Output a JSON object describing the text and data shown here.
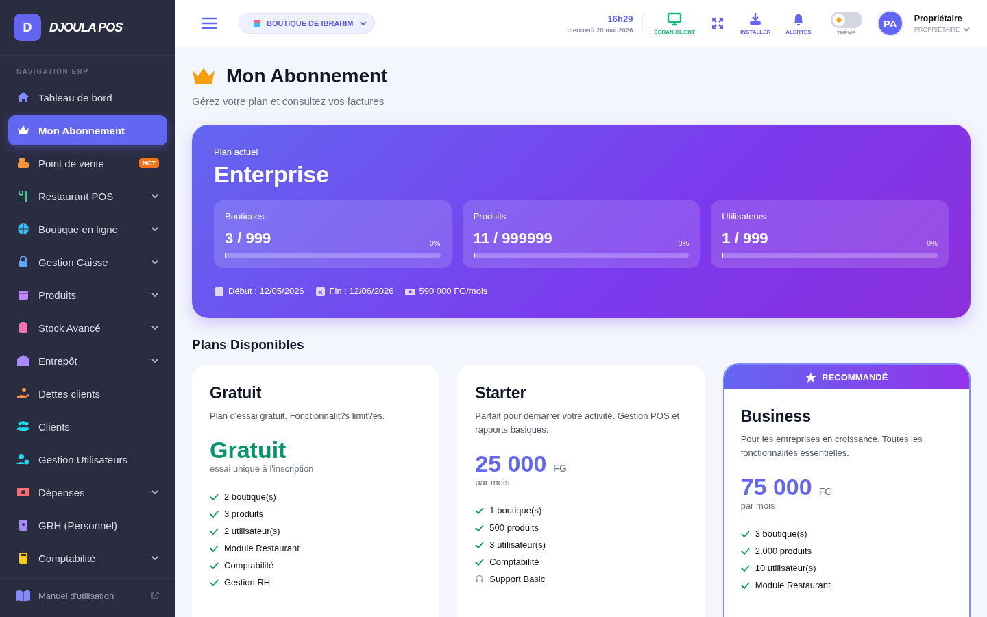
{
  "brand": {
    "initial": "D",
    "name": "DJOULA POS"
  },
  "sidebar": {
    "section": "NAVIGATION ERP",
    "items": [
      {
        "label": "Tableau de bord",
        "selected": false,
        "expandable": false
      },
      {
        "label": "Mon Abonnement",
        "selected": true,
        "expandable": false
      },
      {
        "label": "Point de vente",
        "selected": false,
        "expandable": false,
        "badge": "HOT"
      },
      {
        "label": "Restaurant POS",
        "selected": false,
        "expandable": true
      },
      {
        "label": "Boutique en ligne",
        "selected": false,
        "expandable": true
      },
      {
        "label": "Gestion Caisse",
        "selected": false,
        "expandable": true
      },
      {
        "label": "Produits",
        "selected": false,
        "expandable": true
      },
      {
        "label": "Stock Avancé",
        "selected": false,
        "expandable": true
      },
      {
        "label": "Entrepôt",
        "selected": false,
        "expandable": true
      },
      {
        "label": "Dettes clients",
        "selected": false,
        "expandable": false
      },
      {
        "label": "Clients",
        "selected": false,
        "expandable": false
      },
      {
        "label": "Gestion Utilisateurs",
        "selected": false,
        "expandable": false
      },
      {
        "label": "Dépenses",
        "selected": false,
        "expandable": true
      },
      {
        "label": "GRH (Personnel)",
        "selected": false,
        "expandable": false
      },
      {
        "label": "Comptabilité",
        "selected": false,
        "expandable": true
      }
    ],
    "footer_link": "Manuel d'utilisation"
  },
  "header": {
    "store": "BOUTIQUE DE IBRAHIM",
    "time": "16h29",
    "date": "mercredi 20 mai 2026",
    "actions": [
      {
        "kind": "labeled",
        "label": "ÉCRAN CLIENT"
      },
      {
        "kind": "icon"
      },
      {
        "kind": "labeled",
        "label": "INSTALLER"
      },
      {
        "kind": "labeled",
        "label": "ALERTES"
      }
    ],
    "theme": {
      "label": "THÈME",
      "on": false
    },
    "user": {
      "initials": "PA",
      "name": "Propriétaire",
      "role": "PROPRIÉTAIRE"
    }
  },
  "page": {
    "title": "Mon Abonnement",
    "subtitle": "Gérez votre plan et consultez vos factures"
  },
  "current_plan": {
    "label": "Plan actuel",
    "name": "Enterprise",
    "usage": [
      {
        "label": "Boutiques",
        "value": "3 / 999",
        "percent": "0%",
        "level": 0
      },
      {
        "label": "Produits",
        "value": "11 / 999999",
        "percent": "0%",
        "level": 0
      },
      {
        "label": "Utilisateurs",
        "value": "1 / 999",
        "percent": "0%",
        "level": 0
      }
    ],
    "start": "Début : 12/05/2026",
    "end": "Fin : 12/06/2026",
    "price": "590 000 FG/mois"
  },
  "plans_title": "Plans Disponibles",
  "plans": [
    {
      "name": "Gratuit",
      "recommended": false,
      "description": "Plan d'essai gratuit. Fonctionnalit?s limit?es.",
      "kind": "free",
      "price": "Gratuit",
      "note": "essai unique à l'inscription",
      "features": [
        {
          "kind": "check",
          "text": "2 boutique(s)"
        },
        {
          "kind": "check",
          "text": "3 produits"
        },
        {
          "kind": "check",
          "text": "2 utilisateur(s)"
        },
        {
          "kind": "check",
          "text": "Module Restaurant"
        },
        {
          "kind": "check",
          "text": "Comptabilité"
        },
        {
          "kind": "check",
          "text": "Gestion RH"
        }
      ]
    },
    {
      "name": "Starter",
      "recommended": false,
      "description": "Parfait pour démarrer votre activité. Gestion POS et rapports basiques.",
      "kind": "paid",
      "price": "25 000",
      "currency": "FG",
      "note": "par mois",
      "features": [
        {
          "kind": "check",
          "text": "1 boutique(s)"
        },
        {
          "kind": "check",
          "text": "500 produits"
        },
        {
          "kind": "check",
          "text": "3 utilisateur(s)"
        },
        {
          "kind": "check",
          "text": "Comptabilité"
        },
        {
          "kind": "support",
          "text": "Support Basic"
        }
      ]
    },
    {
      "name": "Business",
      "recommended": true,
      "ribbon": "RECOMMANDÉ",
      "description": "Pour les entreprises en croissance. Toutes les fonctionnalités essentielles.",
      "kind": "paid",
      "price": "75 000",
      "currency": "FG",
      "note": "par mois",
      "features": [
        {
          "kind": "check",
          "text": "3 boutique(s)"
        },
        {
          "kind": "check",
          "text": "2,000 produits"
        },
        {
          "kind": "check",
          "text": "10 utilisateur(s)"
        },
        {
          "kind": "check",
          "text": "Module Restaurant"
        }
      ]
    }
  ]
}
